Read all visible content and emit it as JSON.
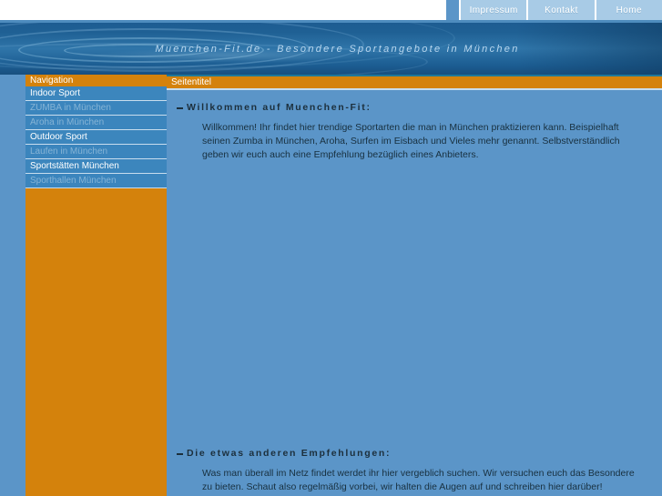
{
  "window": {
    "site_title": "Muenchen-Fit.de"
  },
  "topnav": {
    "items": [
      {
        "label": "Impressum",
        "name": "topnav-item-impressum"
      },
      {
        "label": "Kontakt",
        "name": "topnav-item-kontakt"
      },
      {
        "label": "Home",
        "name": "topnav-item-home"
      }
    ]
  },
  "banner": {
    "title": "Muenchen-Fit.de - Besondere Sportangebote in München"
  },
  "sidebar": {
    "header": "Navigation",
    "items": [
      {
        "label": "Indoor Sport",
        "type": "head"
      },
      {
        "label": "ZUMBA in München",
        "type": "sub"
      },
      {
        "label": "Aroha in München",
        "type": "sub"
      },
      {
        "label": "Outdoor Sport",
        "type": "head"
      },
      {
        "label": "Laufen in München",
        "type": "sub"
      },
      {
        "label": "Sportstätten München",
        "type": "head"
      },
      {
        "label": "Sporthallen München",
        "type": "sub"
      }
    ]
  },
  "main": {
    "page_title": "Seitentitel",
    "sections": [
      {
        "heading": "Willkommen auf Muenchen-Fit:",
        "body": "Willkommen! Ihr findet hier trendige Sportarten die man in München praktizieren kann. Beispielhaft seinen Zumba in München, Aroha, Surfen im Eisbach und Vieles mehr genannt. Selbstverständlich geben wir euch auch eine Empfehlung bezüglich eines Anbieters."
      },
      {
        "heading": "Die etwas anderen Empfehlungen:",
        "body": "Was man überall im Netz findet werdet ihr hier vergeblich suchen. Wir versuchen euch das Besondere zu bieten. Schaut also regelmäßig vorbei, wir halten die Augen auf und schreiben hier darüber!"
      }
    ]
  },
  "colors": {
    "orange": "#d4820c",
    "content_blue": "#5b95c8",
    "nav_item_blue": "#3c86bd",
    "banner_dark_blue": "#1d5c92",
    "topnav_blue": "#a8cbe6",
    "teal_strip": "#1f7899"
  }
}
